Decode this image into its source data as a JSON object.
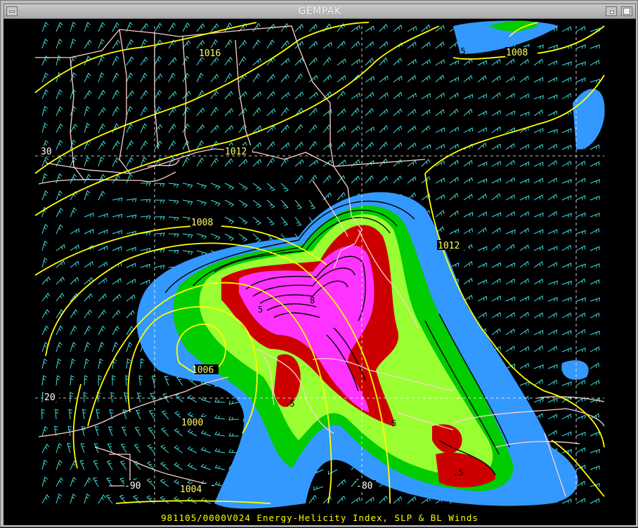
{
  "window": {
    "title": "GEMPAK"
  },
  "map": {
    "caption": "981105/0000V024 Energy-Helicity Index, SLP & BL Winds",
    "isobars": [
      {
        "label": "1016"
      },
      {
        "label": "1012"
      },
      {
        "label": "1008"
      },
      {
        "label": "1012"
      },
      {
        "label": "1008"
      },
      {
        "label": "1006"
      },
      {
        "label": "1000"
      },
      {
        "label": "1004"
      }
    ],
    "latlon_labels": [
      "30",
      "20",
      "-90",
      "-80"
    ],
    "ehi_labels": [
      "1.5",
      "5",
      ".5",
      "5",
      ".5",
      "8"
    ],
    "colors": {
      "background": "#000000",
      "isobar": "#ffff00",
      "barb": "#40e0e0",
      "borders": "#ffd0d0",
      "ehi_levels": [
        "#3399ff",
        "#00cc00",
        "#99ff33",
        "#cc0000",
        "#ff33ff"
      ]
    }
  }
}
